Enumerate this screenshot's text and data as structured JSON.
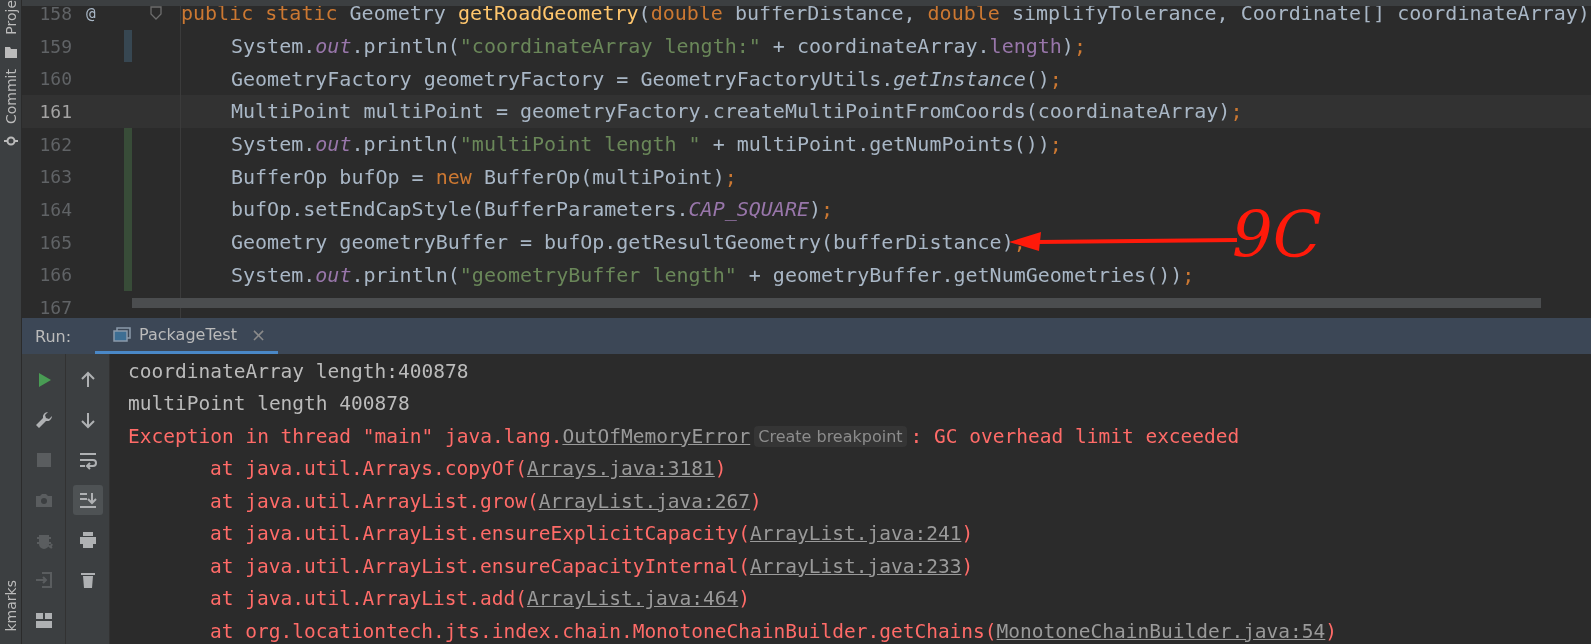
{
  "left_strip": {
    "labels": [
      {
        "text": "Proje",
        "kind": "folder"
      },
      {
        "text": "Commit",
        "kind": "commit"
      },
      {
        "text": "kmarks",
        "kind": "none"
      }
    ]
  },
  "editor": {
    "method": {
      "number": "158",
      "override_mark": "@",
      "tokens": [
        {
          "text": "public static ",
          "kind": "keyword"
        },
        {
          "text": "Geometry ",
          "kind": "plain"
        },
        {
          "text": "getRoadGeometry",
          "kind": "decl"
        },
        {
          "text": "(",
          "kind": "plain"
        },
        {
          "text": "double ",
          "kind": "keyword"
        },
        {
          "text": "bufferDistance, ",
          "kind": "plain"
        },
        {
          "text": "double ",
          "kind": "keyword"
        },
        {
          "text": "simplifyTolerance, Coordinate[] coordinateArray)",
          "kind": "plain"
        }
      ],
      "body": [
        {
          "number": "159",
          "modified": true,
          "added": false,
          "current": false,
          "tokens": [
            {
              "text": "System.",
              "kind": "plain"
            },
            {
              "text": "out",
              "kind": "static"
            },
            {
              "text": ".println(",
              "kind": "plain"
            },
            {
              "text": "\"coordinateArray length:\"",
              "kind": "string"
            },
            {
              "text": " + coordinateArray.",
              "kind": "plain"
            },
            {
              "text": "length",
              "kind": "field"
            },
            {
              "text": ")",
              "kind": "plain"
            },
            {
              "text": ";",
              "kind": "punct"
            }
          ]
        },
        {
          "number": "160",
          "modified": false,
          "added": false,
          "current": false,
          "tokens": [
            {
              "text": "GeometryFactory geometryFactory = GeometryFactoryUtils.",
              "kind": "plain"
            },
            {
              "text": "getInstance",
              "kind": "italic"
            },
            {
              "text": "()",
              "kind": "plain"
            },
            {
              "text": ";",
              "kind": "punct"
            }
          ]
        },
        {
          "number": "161",
          "modified": false,
          "added": false,
          "current": true,
          "tokens": [
            {
              "text": "MultiPoint multiPoint = geometryFactory.createMultiPointFromCoords(coordinateArray)",
              "kind": "plain"
            },
            {
              "text": ";",
              "kind": "punct"
            }
          ]
        },
        {
          "number": "162",
          "modified": false,
          "added": true,
          "current": false,
          "tokens": [
            {
              "text": "System.",
              "kind": "plain"
            },
            {
              "text": "out",
              "kind": "static"
            },
            {
              "text": ".println(",
              "kind": "plain"
            },
            {
              "text": "\"multiPoint length \"",
              "kind": "string"
            },
            {
              "text": " + multiPoint.getNumPoints())",
              "kind": "plain"
            },
            {
              "text": ";",
              "kind": "punct"
            }
          ]
        },
        {
          "number": "163",
          "modified": false,
          "added": true,
          "current": false,
          "tokens": [
            {
              "text": "BufferOp bufOp = ",
              "kind": "plain"
            },
            {
              "text": "new ",
              "kind": "keyword"
            },
            {
              "text": "BufferOp(multiPoint)",
              "kind": "plain"
            },
            {
              "text": ";",
              "kind": "punct"
            }
          ]
        },
        {
          "number": "164",
          "modified": false,
          "added": true,
          "current": false,
          "tokens": [
            {
              "text": "bufOp.setEndCapStyle(BufferParameters.",
              "kind": "plain"
            },
            {
              "text": "CAP_SQUARE",
              "kind": "static"
            },
            {
              "text": ")",
              "kind": "plain"
            },
            {
              "text": ";",
              "kind": "punct"
            }
          ]
        },
        {
          "number": "165",
          "modified": false,
          "added": true,
          "current": false,
          "tokens": [
            {
              "text": "Geometry geometryBuffer = bufOp.getResultGeometry(bufferDistance)",
              "kind": "plain"
            },
            {
              "text": ";",
              "kind": "punct"
            }
          ]
        },
        {
          "number": "166",
          "modified": false,
          "added": true,
          "current": false,
          "tokens": [
            {
              "text": "System.",
              "kind": "plain"
            },
            {
              "text": "out",
              "kind": "static"
            },
            {
              "text": ".println(",
              "kind": "plain"
            },
            {
              "text": "\"geometryBuffer length\"",
              "kind": "string"
            },
            {
              "text": " + geometryBuffer.getNumGeometries())",
              "kind": "plain"
            },
            {
              "text": ";",
              "kind": "punct"
            }
          ]
        },
        {
          "number": "167",
          "modified": false,
          "added": false,
          "current": false
        }
      ]
    },
    "annotation": {
      "text": "9C"
    }
  },
  "run_panel": {
    "label": "Run:",
    "tabs": [
      {
        "label": "PackageTest",
        "selected": true,
        "close": "×"
      }
    ],
    "toolbar_1": [
      {
        "kind": "play",
        "disabled": false
      },
      {
        "kind": "wrench",
        "disabled": false
      },
      {
        "kind": "stop",
        "disabled": true
      },
      {
        "kind": "camera",
        "disabled": true
      },
      {
        "kind": "bug",
        "disabled": true
      },
      {
        "kind": "exit",
        "disabled": true
      },
      {
        "kind": "layout",
        "disabled": false
      }
    ],
    "toolbar_2": [
      {
        "kind": "up",
        "selected": false
      },
      {
        "kind": "down",
        "selected": false
      },
      {
        "kind": "wrap",
        "selected": false
      },
      {
        "kind": "scroll-end",
        "selected": true
      },
      {
        "kind": "print",
        "selected": false
      },
      {
        "kind": "trash",
        "selected": false
      }
    ],
    "console": [
      {
        "kind": "output",
        "segments": [
          {
            "text": "coordinateArray length:400878",
            "kind": "plain"
          }
        ]
      },
      {
        "kind": "output",
        "segments": [
          {
            "text": "multiPoint length 400878",
            "kind": "plain"
          }
        ]
      },
      {
        "kind": "error",
        "segments": [
          {
            "text": "Exception in thread \"main\" java.lang.",
            "kind": "plain"
          },
          {
            "text": "OutOfMemoryError",
            "kind": "link"
          },
          {
            "text": "Create breakpoint",
            "kind": "hint"
          },
          {
            "text": ": GC overhead limit exceeded",
            "kind": "plain"
          }
        ]
      },
      {
        "kind": "frame",
        "segments": [
          {
            "text": "at java.util.Arrays.copyOf(",
            "kind": "plain"
          },
          {
            "text": "Arrays.java:3181",
            "kind": "link"
          },
          {
            "text": ")",
            "kind": "plain"
          }
        ]
      },
      {
        "kind": "frame",
        "segments": [
          {
            "text": "at java.util.ArrayList.grow(",
            "kind": "plain"
          },
          {
            "text": "ArrayList.java:267",
            "kind": "link"
          },
          {
            "text": ")",
            "kind": "plain"
          }
        ]
      },
      {
        "kind": "frame",
        "segments": [
          {
            "text": "at java.util.ArrayList.ensureExplicitCapacity(",
            "kind": "plain"
          },
          {
            "text": "ArrayList.java:241",
            "kind": "link"
          },
          {
            "text": ")",
            "kind": "plain"
          }
        ]
      },
      {
        "kind": "frame",
        "segments": [
          {
            "text": "at java.util.ArrayList.ensureCapacityInternal(",
            "kind": "plain"
          },
          {
            "text": "ArrayList.java:233",
            "kind": "link"
          },
          {
            "text": ")",
            "kind": "plain"
          }
        ]
      },
      {
        "kind": "frame",
        "segments": [
          {
            "text": "at java.util.ArrayList.add(",
            "kind": "plain"
          },
          {
            "text": "ArrayList.java:464",
            "kind": "link"
          },
          {
            "text": ")",
            "kind": "plain"
          }
        ]
      },
      {
        "kind": "frame",
        "segments": [
          {
            "text": "at org.locationtech.jts.index.chain.MonotoneChainBuilder.getChains(",
            "kind": "plain"
          },
          {
            "text": "MonotoneChainBuilder.java:54",
            "kind": "link"
          },
          {
            "text": ")",
            "kind": "plain"
          }
        ]
      }
    ]
  }
}
